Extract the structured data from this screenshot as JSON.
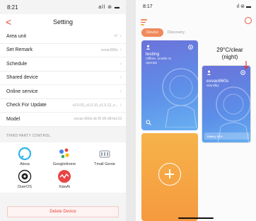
{
  "left": {
    "status": {
      "time": "8:21",
      "signal": "all ⊜ ▬"
    },
    "nav": {
      "title": "Setting",
      "back": "<"
    },
    "rows": [
      {
        "label": "Area unit",
        "value": "n°"
      },
      {
        "label": "Set Remark",
        "value": "exvac660s"
      },
      {
        "label": "Schedule",
        "value": ""
      },
      {
        "label": "Shared device",
        "value": ""
      },
      {
        "label": "Online service",
        "value": ""
      },
      {
        "label": "Check For Update",
        "value": "v3.0.03_v1.0.10_v1.0.12_s..."
      },
      {
        "label": "Model",
        "value": "exvac-660s-dc-f5-05-d8-bd-23"
      }
    ],
    "third_party_header": "THIRD PARTY CONTROL",
    "third_party": [
      {
        "label": "Alexa",
        "icon": "alexa-icon"
      },
      {
        "label": "GoogleHome",
        "icon": "google-home-icon"
      },
      {
        "label": "Tmall Genie",
        "icon": "tmall-genie-icon"
      },
      {
        "label": "DuerOS",
        "icon": "dueros-icon"
      },
      {
        "label": "XiaoAi",
        "icon": "xiaoai-icon"
      }
    ],
    "delete_label": "Delete Device",
    "accent": "#e8473d"
  },
  "right": {
    "status": {
      "time": "8:17",
      "signal": "ıl ⊜ ▬"
    },
    "tabs": {
      "active": "Device",
      "other": "Discovery"
    },
    "cards": [
      {
        "name": "testing",
        "status": "Offline, unable to operate"
      },
      {
        "name": "exvac660s",
        "status": "Standby",
        "bar_text": "Battery 99%"
      }
    ],
    "annotation": "29°C/clear (night)",
    "menu_colors": [
      "#f08a5d",
      "#e8573d",
      "#f4b24c"
    ]
  }
}
